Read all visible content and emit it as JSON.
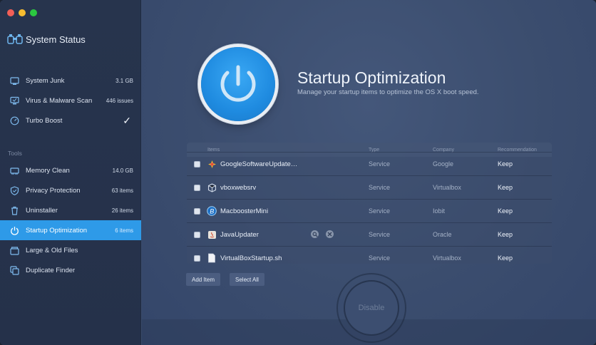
{
  "sidebar": {
    "brand": "System Status",
    "items": [
      {
        "label": "System Junk",
        "value": "3.1 GB",
        "icon": "junk-icon"
      },
      {
        "label": "Virus & Malware Scan",
        "value": "446 issues",
        "icon": "monitor-icon"
      },
      {
        "label": "Turbo Boost",
        "value": "",
        "icon": "speedometer-icon",
        "check": "✓"
      }
    ],
    "section_label": "Tools",
    "tools": [
      {
        "label": "Memory Clean",
        "value": "14.0 GB",
        "icon": "memory-icon"
      },
      {
        "label": "Privacy Protection",
        "value": "63 items",
        "icon": "shield-icon"
      },
      {
        "label": "Uninstaller",
        "value": "26 items",
        "icon": "trash-icon"
      },
      {
        "label": "Startup Optimization",
        "value": "6 items",
        "icon": "power-icon",
        "active": true
      },
      {
        "label": "Large & Old Files",
        "value": "",
        "icon": "files-icon"
      },
      {
        "label": "Duplicate Finder",
        "value": "",
        "icon": "duplicate-icon"
      }
    ]
  },
  "main": {
    "title": "Startup Optimization",
    "subtitle": "Manage your startup items to optimize the OS X boot speed.",
    "table": {
      "headers": {
        "items": "Items",
        "type": "Type",
        "company": "Company",
        "recommendation": "Recommendation"
      },
      "rows": [
        {
          "name": "GoogleSoftwareUpdate…",
          "type": "Service",
          "company": "Google",
          "recommendation": "Keep"
        },
        {
          "name": "vboxwebsrv",
          "type": "Service",
          "company": "Virtualbox",
          "recommendation": "Keep"
        },
        {
          "name": "MacboosterMini",
          "type": "Service",
          "company": "Iobit",
          "recommendation": "Keep"
        },
        {
          "name": "JavaUpdater",
          "type": "Service",
          "company": "Oracle",
          "recommendation": "Keep"
        },
        {
          "name": "VirtualBoxStartup.sh",
          "type": "Service",
          "company": "Virtualbox",
          "recommendation": "Keep"
        }
      ]
    },
    "add_item_label": "Add Item",
    "select_all_label": "Select All",
    "disable_label": "Disable"
  },
  "colors": {
    "accent": "#2e9ae8",
    "sidebar_bg": "#27344d",
    "main_bg": "#3b4d6e"
  }
}
